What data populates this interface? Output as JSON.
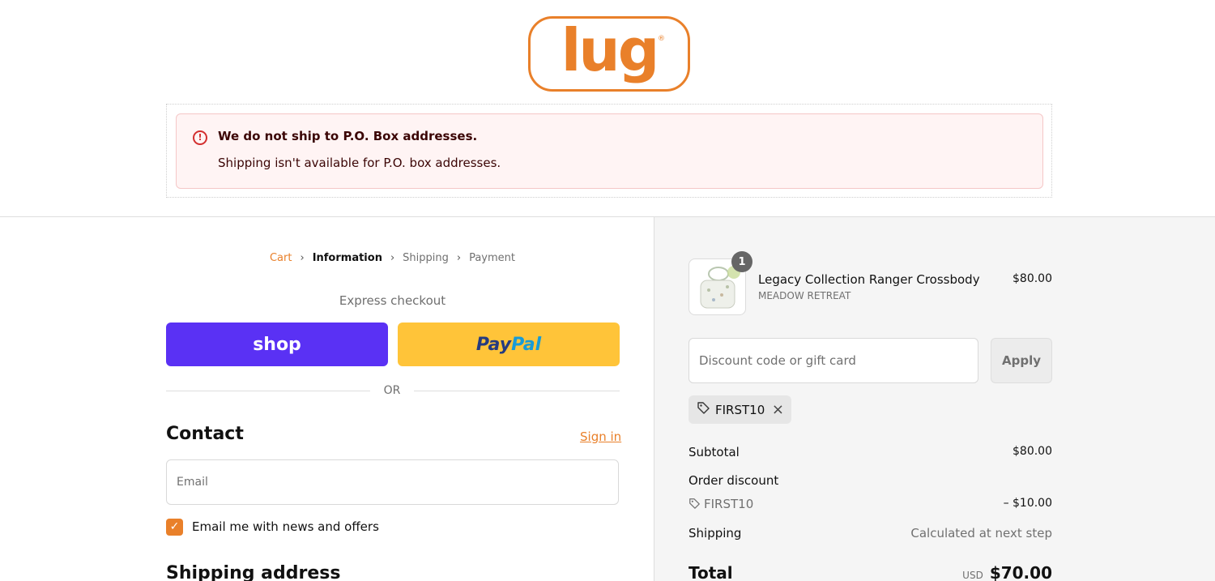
{
  "brand": {
    "logo_text": "lug",
    "logo_mark": "®",
    "accent": "#e9802a"
  },
  "alert": {
    "title": "We do not ship to P.O. Box addresses.",
    "message": "Shipping isn't available for P.O. box addresses."
  },
  "breadcrumb": {
    "items": [
      {
        "label": "Cart",
        "state": "link"
      },
      {
        "label": "Information",
        "state": "current"
      },
      {
        "label": "Shipping",
        "state": "upcoming"
      },
      {
        "label": "Payment",
        "state": "upcoming"
      }
    ]
  },
  "express": {
    "title": "Express checkout",
    "shop_label": "shop",
    "paypal_label_a": "Pay",
    "paypal_label_b": "Pal",
    "or_label": "OR"
  },
  "contact": {
    "title": "Contact",
    "signin_label": "Sign in",
    "email_placeholder": "Email",
    "email_value": "",
    "newsletter_label": "Email me with news and offers",
    "newsletter_checked": true
  },
  "shipping": {
    "title": "Shipping address"
  },
  "cart": {
    "product": {
      "name": "Legacy Collection Ranger Crossbody",
      "variant": "MEADOW RETREAT",
      "price": "$80.00",
      "quantity": "1"
    },
    "discount_placeholder": "Discount code or gift card",
    "apply_label": "Apply",
    "applied_code": "FIRST10"
  },
  "summary": {
    "subtotal_label": "Subtotal",
    "subtotal_value": "$80.00",
    "discount_label": "Order discount",
    "discount_code": "FIRST10",
    "discount_value": "– $10.00",
    "shipping_label": "Shipping",
    "shipping_value": "Calculated at next step",
    "total_label": "Total",
    "currency": "USD",
    "total_value": "$70.00"
  }
}
